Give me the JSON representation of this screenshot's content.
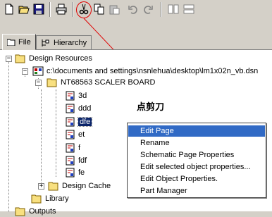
{
  "tabs": [
    {
      "label": "File",
      "active": true
    },
    {
      "label": "Hierarchy",
      "active": false
    }
  ],
  "tree": {
    "root": "Design Resources",
    "dsn_path": "c:\\documents and settings\\nsnlehua\\desktop\\lm1x02n_vb.dsn",
    "board": "NT68563 SCALER BOARD",
    "pages": [
      "3d",
      "ddd",
      "dfe",
      "et",
      "f",
      "fdf",
      "fe"
    ],
    "selected_page": "dfe",
    "design_cache": "Design Cache",
    "library": "Library",
    "outputs": "Outputs"
  },
  "context_menu": {
    "items": [
      "Edit Page",
      "Rename",
      "Schematic Page Properties",
      "Edit selected object properties...",
      "Edit Object Properties.",
      "Part Manager"
    ],
    "hover_index": 0
  },
  "annotation": "点剪刀",
  "colors": {
    "annotation_line": "#e00000",
    "selection": "#0a246a",
    "menu_hover": "#316ac5"
  }
}
